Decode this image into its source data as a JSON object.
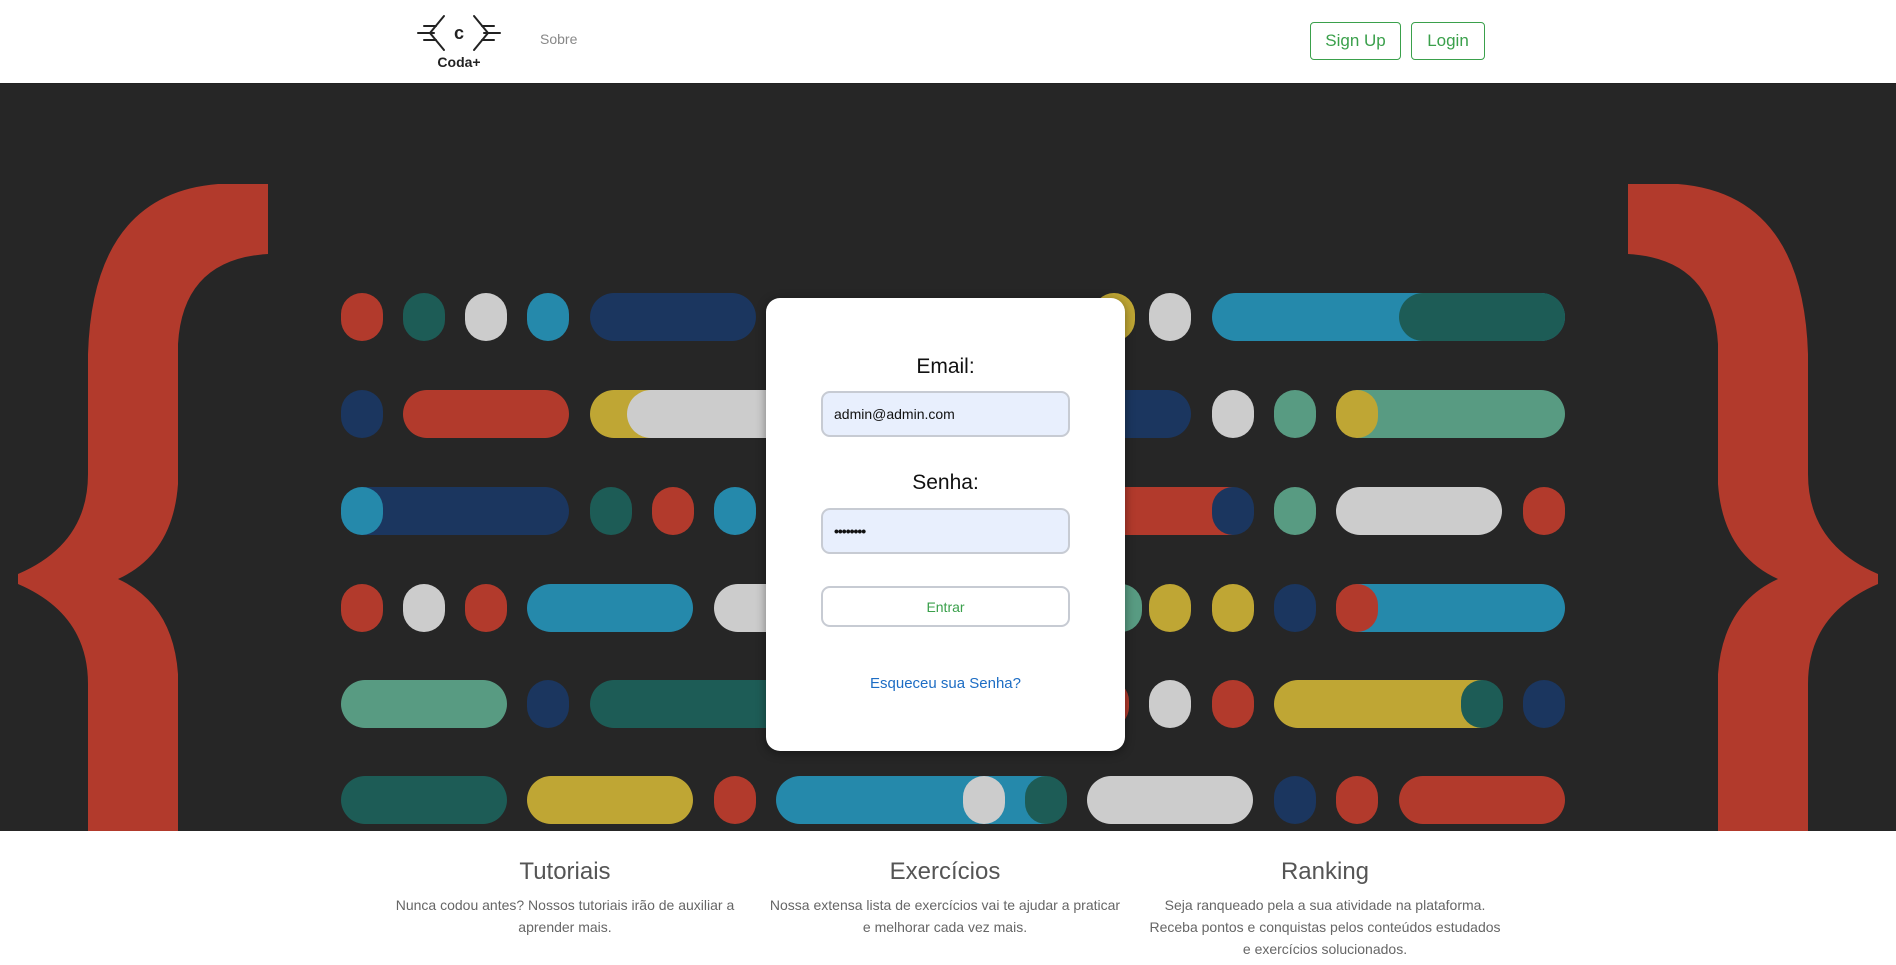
{
  "header": {
    "logo_text": "Coda+",
    "logo_letter": "c",
    "nav_about": "Sobre",
    "signup_label": "Sign Up",
    "login_label": "Login"
  },
  "login_card": {
    "email_label": "Email:",
    "email_value": "admin@admin.com",
    "password_label": "Senha:",
    "password_value": "••••••••",
    "submit_label": "Entrar",
    "forgot_link": "Esqueceu sua Senha?"
  },
  "features": [
    {
      "title": "Tutoriais",
      "description": "Nunca codou antes? Nossos tutoriais irão de auxiliar a aprender mais."
    },
    {
      "title": "Exercícios",
      "description": "Nossa extensa lista de exercícios vai te ajudar a praticar e melhorar cada vez mais."
    },
    {
      "title": "Ranking",
      "description": "Seja ranqueado pela a sua atividade na plataforma. Receba pontos e conquistas pelos conteúdos estudados e exercícios solucionados."
    }
  ],
  "colors": {
    "accent_green": "#3aa04b",
    "link_blue": "#1d6dc4",
    "hero_bg": "#262626",
    "brace_red": "#b23a2c",
    "palette": [
      "#b23a2c",
      "#1d5c56",
      "#cccccc",
      "#2589ab",
      "#1b365f",
      "#bfa634",
      "#589b82"
    ]
  }
}
